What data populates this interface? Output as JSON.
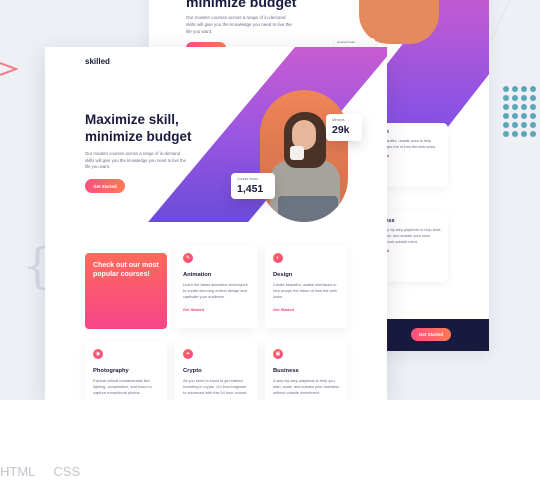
{
  "back_preview": {
    "title": "minimize budget",
    "subtitle": "Our modern courses across a range of in-demand skills will give you the knowledge you need to live the life you want.",
    "stat_label": "Course hours",
    "cards": [
      {
        "title": "gn",
        "text": "beautiful, usable aces to help shape the of how the web looks.",
        "link": "rted"
      },
      {
        "title": "ness",
        "text": "step-by-step playbook to help start, scale, and sustain your ness without outside ment.",
        "link": "rted"
      }
    ],
    "footer_button": "Get Started"
  },
  "header": {
    "logo": "skilled",
    "cta": "Get Started"
  },
  "hero": {
    "title": "Maximize skill, minimize budget",
    "subtitle": "Our modern courses across a range of in-demand skills will give you the knowledge you need to live the life you want.",
    "cta": "Get Started"
  },
  "stats": {
    "mentors_label": "Mentors",
    "mentors_value": "29k",
    "courses_label": "Course hours",
    "courses_value": "1,451"
  },
  "featured": {
    "text": "Check out our most popular courses!"
  },
  "courses": [
    {
      "icon": "animation-icon",
      "title": "Animation",
      "text": "Learn the latest animation techniques to create stunning motion design and captivate your audience.",
      "link": "Get Started"
    },
    {
      "icon": "design-icon",
      "title": "Design",
      "text": "Create beautiful, usable interfaces to help shape the future of how the web looks.",
      "link": "Get Started"
    },
    {
      "icon": "photography-icon",
      "title": "Photography",
      "text": "Explore critical fundamentals like lighting, composition, and focus to capture exceptional photos."
    },
    {
      "icon": "crypto-icon",
      "title": "Crypto",
      "text": "All you need to know to get started investing in crypto. Go from beginner to advanced with this 54 hour course."
    },
    {
      "icon": "business-icon",
      "title": "Business",
      "text": "A step-by-step playbook to help you start, scale, and sustain your business without outside investment."
    }
  ],
  "tags": {
    "html": "HTML",
    "css": "CSS"
  },
  "colors": {
    "navy": "#171a3e",
    "accent_pink": "#f5458a",
    "accent_orange": "#ff6a5a",
    "accent_purple": "#7c4fe8"
  }
}
